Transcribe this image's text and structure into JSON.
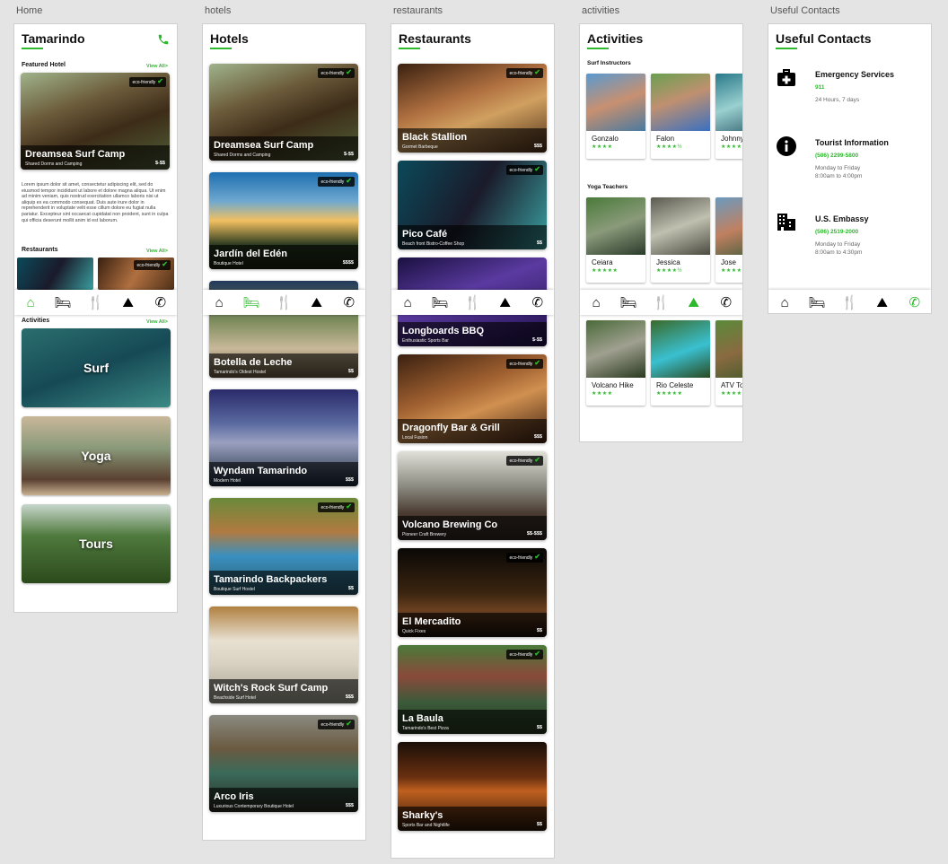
{
  "artboard_labels": {
    "home": "Home",
    "hotels": "hotels",
    "restaurants": "restaurants",
    "activities": "activities",
    "contacts": "Useful Contacts"
  },
  "colors": {
    "accent": "#2db82d",
    "overlay": "rgba(0,0,0,0.62)",
    "board": "#ffffff",
    "canvas": "#e4e4e4"
  },
  "eco_badge": {
    "label": "eco-friendly",
    "icon": "check-icon"
  },
  "nav_icons": [
    "home-icon",
    "hotel-icon",
    "restaurant-icon",
    "activities-icon",
    "phone-icon"
  ],
  "home": {
    "title": "Tamarindo",
    "phone_icon": "phone-icon",
    "featured_label": "Featured Hotel",
    "view_all": "View All>",
    "featured": {
      "name": "Dreamsea Surf Camp",
      "sub": "Shared Dorms and Camping",
      "price": "$-$$"
    },
    "lorem": "Lorem ipsum dolor sit amet, consectetur adipiscing elit, sed do eiusmod tempor incididunt ut labore et dolore magna aliqua. Ut enim ad minim veniam, quis nostrud exercitation ullamco laboris nisi ut aliquip ex ea commodo consequat. Duis aute irure dolor in reprehenderit in voluptate velit esse cillum dolore eu fugiat nulla pariatur. Excepteur sint occaecat cupidatat non proident, sunt in culpa qui officia deserunt mollit anim id est laborum.",
    "restaurants_label": "Restaurants",
    "activities_label": "Activities",
    "activities": [
      "Surf",
      "Yoga",
      "Tours"
    ]
  },
  "hotels": {
    "title": "Hotels",
    "items": [
      {
        "name": "Dreamsea Surf Camp",
        "sub": "Shared Dorms and Camping",
        "price": "$-$$"
      },
      {
        "name": "Jardín del Edén",
        "sub": "Boutique Hotel",
        "price": "$$$$"
      },
      {
        "name": "Botella de Leche",
        "sub": "Tamarindo's Oldest Hostel",
        "price": "$$"
      },
      {
        "name": "Wyndam Tamarindo",
        "sub": "Modern Hotel",
        "price": "$$$"
      },
      {
        "name": "Tamarindo Backpackers",
        "sub": "Boutique Surf Hostel",
        "price": "$$"
      },
      {
        "name": "Witch's Rock Surf Camp",
        "sub": "Beachside Surf Hotel",
        "price": "$$$"
      },
      {
        "name": "Arco Iris",
        "sub": "Luxurious Contemporary Boutique Hotel",
        "price": "$$$"
      }
    ]
  },
  "restaurants": {
    "title": "Restaurants",
    "items": [
      {
        "name": "Black Stallion",
        "sub": "Gormet Barbeque",
        "price": "$$$"
      },
      {
        "name": "Pico Café",
        "sub": "Beach front Bistro-Coffee Shop",
        "price": "$$"
      },
      {
        "name": "Longboards BBQ",
        "sub": "Enthusiastic Sports Bar",
        "price": "$-$$"
      },
      {
        "name": "Dragonfly Bar & Grill",
        "sub": "Local Fusion",
        "price": "$$$"
      },
      {
        "name": "Volcano Brewing Co",
        "sub": "Pioneer Craft Brewery",
        "price": "$$-$$$"
      },
      {
        "name": "El Mercadito",
        "sub": "Quick Fixes",
        "price": "$$"
      },
      {
        "name": "La Baula",
        "sub": "Tamarindo's Best Pizza",
        "price": "$$"
      },
      {
        "name": "Sharky's",
        "sub": "Sports Bar and Nightlife",
        "price": "$$"
      }
    ]
  },
  "activities": {
    "title": "Activities",
    "surf_label": "Surf Instructors",
    "yoga_label": "Yoga Teachers",
    "surf": [
      {
        "name": "Gonzalo",
        "stars": "★★★★",
        "rating": 4
      },
      {
        "name": "Falon",
        "stars": "★★★★½",
        "rating": 4.5
      },
      {
        "name": "Johnny",
        "stars": "★★★★",
        "rating": 4
      }
    ],
    "yoga": [
      {
        "name": "Ceiara",
        "stars": "★★★★★",
        "rating": 5
      },
      {
        "name": "Jessica",
        "stars": "★★★★½",
        "rating": 4.5
      },
      {
        "name": "Jose",
        "stars": "★★★★",
        "rating": 4
      }
    ],
    "tours": [
      {
        "name": "Volcano Hike",
        "stars": "★★★★",
        "rating": 4
      },
      {
        "name": "Rio Celeste",
        "stars": "★★★★★",
        "rating": 5
      },
      {
        "name": "ATV Tour",
        "stars": "★★★★",
        "rating": 4
      }
    ]
  },
  "contacts": {
    "title": "Useful Contacts",
    "items": [
      {
        "name": "Emergency Services",
        "number": "911",
        "hours": "24 Hours, 7 days",
        "icon": "medical-kit-icon"
      },
      {
        "name": "Tourist Information",
        "number": "(506) 2299-5800",
        "hours": "Monday to Friday\n8:00am to 4:00pm",
        "icon": "info-icon"
      },
      {
        "name": "U.S. Embassy",
        "number": "(506) 2519-2000",
        "hours": "Monday to Friday\n8:00am to 4:30pm",
        "icon": "embassy-building-icon"
      }
    ]
  }
}
